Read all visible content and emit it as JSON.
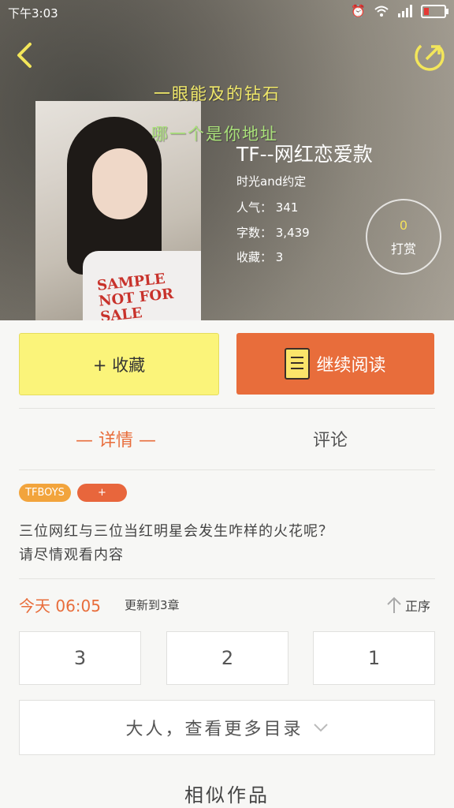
{
  "status_bar": {
    "time": "下午3:03"
  },
  "hero": {
    "tagline_1": "一眼能及的钻石",
    "tagline_2": "哪一个是你地址",
    "cover_text": "SAMPLE NOT FOR SALE",
    "title": "TF--网红恋爱款",
    "author": "时光and约定",
    "popularity": "人气： 341",
    "word_count": "字数： 3,439",
    "favorites": "收藏： 3",
    "tip": {
      "count": "0",
      "label": "打赏"
    }
  },
  "actions": {
    "favorite_label": "+ 收藏",
    "continue_label": "继续阅读"
  },
  "tabs": {
    "detail": "— 详情 —",
    "comments": "评论"
  },
  "tags": [
    "TFBOYS",
    "+"
  ],
  "description": {
    "line1": "三位网红与三位当红明星会发生咋样的火花呢？",
    "line2": "请尽情观看内容"
  },
  "update": {
    "time": "今天 06:05",
    "status": "更新到3章",
    "sort_label": "正序"
  },
  "chapters": [
    "3",
    "2",
    "1"
  ],
  "more_label": "大人，查看更多目录",
  "similar_title": "相似作品",
  "colors": {
    "accent": "#e86d3b",
    "favorite_bg": "#fbf47a",
    "tag_orange": "#f2a43c"
  }
}
